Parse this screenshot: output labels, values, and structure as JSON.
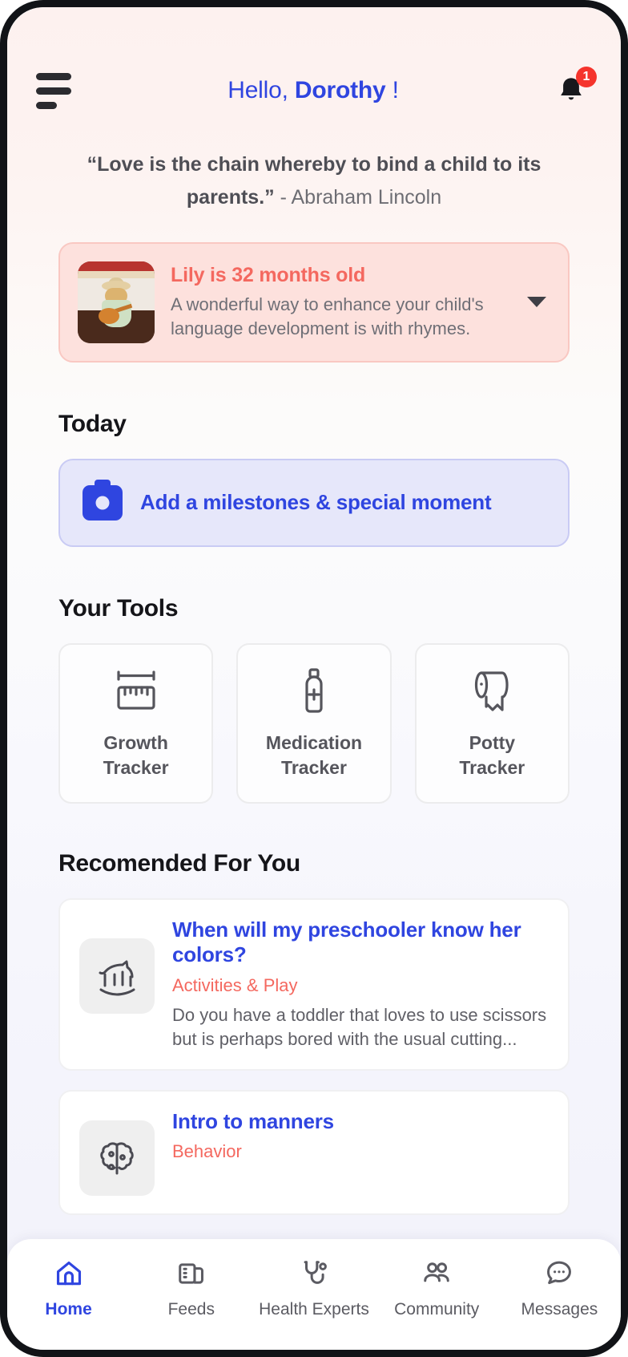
{
  "header": {
    "greeting_prefix": "Hello, ",
    "user_name": "Dorothy",
    "greeting_suffix": " !",
    "menu_icon": "hamburger-menu-icon",
    "bell_icon": "notification-bell-icon",
    "notification_count": "1"
  },
  "quote": {
    "text": "“Love is the chain whereby to bind a child to its parents.”",
    "author": " - Abraham Lincoln"
  },
  "child_banner": {
    "title": "Lily is 32 months old",
    "description": "A wonderful way to enhance your child's language development is with rhymes.",
    "photo_alt": "child-photo",
    "expand_icon": "chevron-down-icon",
    "accent_color": "#f4685f",
    "background_color": "#fde1dd"
  },
  "today": {
    "title": "Today",
    "milestone_label": "Add a milestones & special moment",
    "milestone_icon": "camera-icon",
    "accent_color": "#2f45e0"
  },
  "tools": {
    "title": "Your Tools",
    "items": [
      {
        "label_line1": "Growth",
        "label_line2": "Tracker",
        "icon": "ruler-icon"
      },
      {
        "label_line1": "Medication",
        "label_line2": "Tracker",
        "icon": "medicine-bottle-icon"
      },
      {
        "label_line1": "Potty",
        "label_line2": "Tracker",
        "icon": "toilet-paper-icon"
      }
    ]
  },
  "recommended": {
    "title": "Recomended For You",
    "items": [
      {
        "title": "When will my preschooler know her colors?",
        "category": "Activities & Play",
        "description": "Do you have a toddler that loves to use scissors but is perhaps bored with the usual cutting...",
        "icon": "rocking-horse-icon"
      },
      {
        "title": "Intro to manners",
        "category": "Behavior",
        "description": "",
        "icon": "brain-icon"
      }
    ]
  },
  "bottom_nav": {
    "items": [
      {
        "label": "Home",
        "icon": "home-icon",
        "active": true
      },
      {
        "label": "Feeds",
        "icon": "feeds-icon",
        "active": false
      },
      {
        "label": "Health Experts",
        "icon": "stethoscope-icon",
        "active": false
      },
      {
        "label": "Community",
        "icon": "people-icon",
        "active": false
      },
      {
        "label": "Messages",
        "icon": "chat-bubble-icon",
        "active": false
      }
    ]
  }
}
